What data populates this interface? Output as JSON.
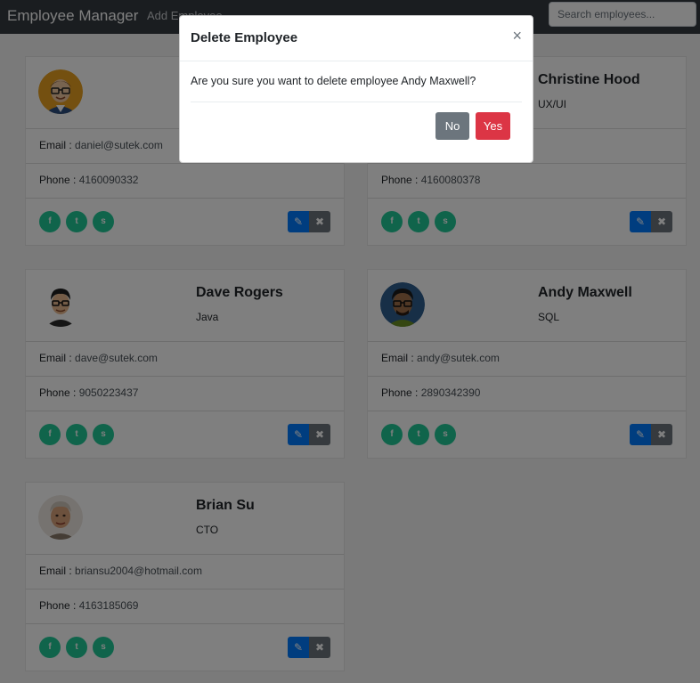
{
  "navbar": {
    "brand": "Employee Manager",
    "add_link": "Add Employee",
    "search_placeholder": "Search employees..."
  },
  "labels": {
    "email": "Email : ",
    "phone": "Phone : "
  },
  "employees": [
    {
      "name": "",
      "role": "",
      "email": "daniel@sutek.com",
      "phone": "4160090332"
    },
    {
      "name": "Christine Hood",
      "role": "UX/UI",
      "email": "",
      "phone": "4160080378"
    },
    {
      "name": "Dave Rogers",
      "role": "Java",
      "email": "dave@sutek.com",
      "phone": "9050223437"
    },
    {
      "name": "Andy Maxwell",
      "role": "SQL",
      "email": "andy@sutek.com",
      "phone": "2890342390"
    },
    {
      "name": "Brian Su",
      "role": "CTO",
      "email": "briansu2004@hotmail.com",
      "phone": "4163185069"
    }
  ],
  "socials": [
    {
      "icon": "facebook-icon",
      "glyph": "f"
    },
    {
      "icon": "twitter-icon",
      "glyph": "t"
    },
    {
      "icon": "skype-icon",
      "glyph": "s"
    }
  ],
  "actions": {
    "edit_glyph": "✎",
    "delete_glyph": "✖"
  },
  "modal": {
    "title": "Delete Employee",
    "close": "×",
    "message": "Are you sure you want to delete employee Andy Maxwell?",
    "no_label": "No",
    "yes_label": "Yes"
  },
  "colors": {
    "navbar": "#343a40",
    "social": "#20c997",
    "edit": "#007bff",
    "delete": "#6c757d",
    "yes": "#dc3545"
  }
}
